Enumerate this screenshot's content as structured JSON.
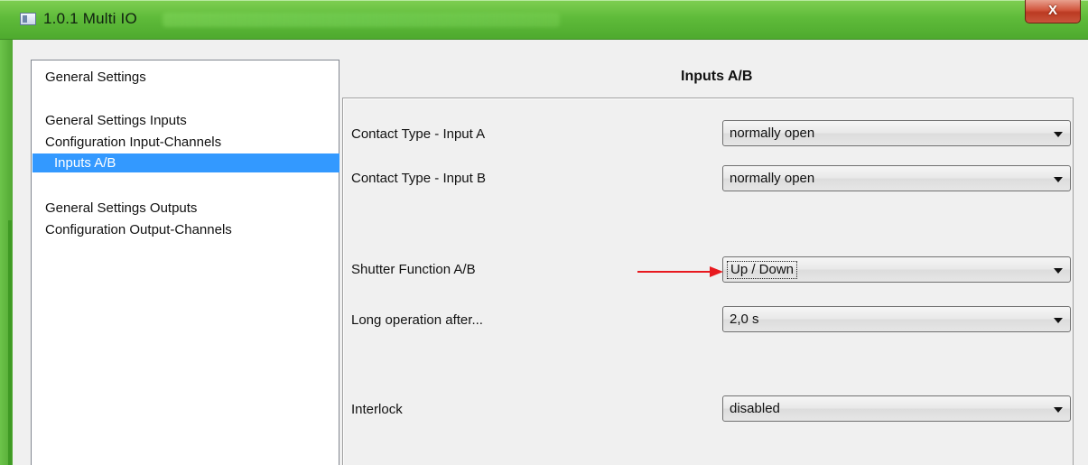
{
  "window": {
    "title": "1.0.1 Multi IO",
    "close_label": "X"
  },
  "nav": {
    "items": [
      {
        "label": "General Settings"
      },
      {
        "label": "General Settings Inputs"
      },
      {
        "label": "Configuration Input-Channels"
      },
      {
        "label": "Inputs A/B",
        "selected": true
      },
      {
        "label": "General Settings Outputs"
      },
      {
        "label": "Configuration Output-Channels"
      }
    ]
  },
  "panel": {
    "title": "Inputs A/B",
    "fields": [
      {
        "label": "Contact Type - Input A",
        "value": "normally open"
      },
      {
        "label": "Contact Type - Input B",
        "value": "normally open"
      },
      {
        "label": "Shutter Function A/B",
        "value": "Up / Down",
        "focused": true
      },
      {
        "label": "Long operation after...",
        "value": "2,0 s"
      },
      {
        "label": "Interlock",
        "value": "disabled"
      }
    ]
  },
  "colors": {
    "title_bar": "#5fbb3a",
    "selection": "#3399ff",
    "annotation_arrow": "#e8191f",
    "close_button": "#c9402a"
  },
  "icons": {
    "app": "window-app-icon",
    "close": "close-icon",
    "dropdown": "chevron-down-icon",
    "annotation": "red-arrow-icon"
  }
}
